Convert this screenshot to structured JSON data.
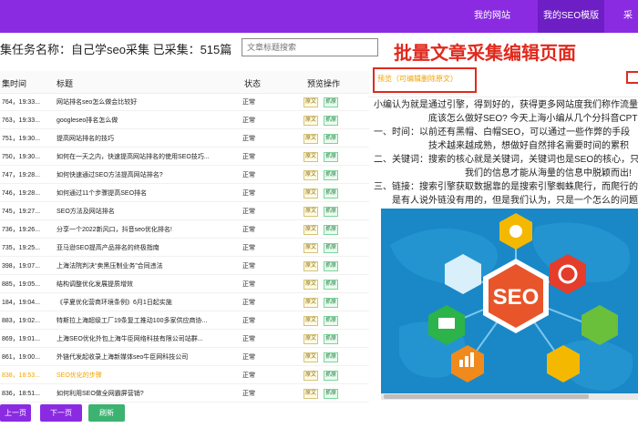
{
  "topbar": {
    "nav": [
      "我的网站",
      "我的SEO模版",
      "采集"
    ]
  },
  "task": {
    "text": "集任务名称：自己学seo采集 已采集：515篇"
  },
  "search": {
    "placeholder": "文章标题搜索"
  },
  "big_title": "批量文章采集编辑页面",
  "table": {
    "headers": [
      "集时间",
      "标题",
      "状态",
      "预览操作"
    ],
    "rows": [
      {
        "time": "764，19:33...",
        "title": "网站排名seo怎么做会比较好",
        "status": "正常"
      },
      {
        "time": "763，19:33...",
        "title": "googleseo排名怎么做",
        "status": "正常"
      },
      {
        "time": "751，19:30...",
        "title": "提高网站排名的技巧",
        "status": "正常"
      },
      {
        "time": "750，19:30...",
        "title": "如何在一天之内，快速提高网站排名的使用SEO技巧...",
        "status": "正常"
      },
      {
        "time": "747，19:28...",
        "title": "如何快速通过SEO方法提高网站排名?",
        "status": "正常"
      },
      {
        "time": "746，19:28...",
        "title": "如何通过11个步骤提高SEO排名",
        "status": "正常"
      },
      {
        "time": "745，19:27...",
        "title": "SEO方法及网站排名",
        "status": "正常"
      },
      {
        "time": "736，19:26...",
        "title": "分享一个2022新风口，抖音seo优化排名!",
        "status": "正常"
      },
      {
        "time": "735，19:25...",
        "title": "亚马逊SEO提高产品排名的终极指南",
        "status": "正常"
      },
      {
        "time": "398，19:07...",
        "title": "上海法院判决“卖黑压制业务”合同违法",
        "status": "正常"
      },
      {
        "time": "885，19:05...",
        "title": "结构调整优化发展提质增效",
        "status": "正常"
      },
      {
        "time": "184，19:04...",
        "title": "《孚夏优化营商环境条例》6月1日起实施",
        "status": "正常"
      },
      {
        "time": "883，19:02...",
        "title": "特斯拉上海超级工厂19条复工推动100多家供应商协...",
        "status": "正常"
      },
      {
        "time": "869，19:01...",
        "title": "上海SEO优化外包上海牛臣网络科技有限公司站群...",
        "status": "正常"
      },
      {
        "time": "861，19:00...",
        "title": "外链代发起收录上海新媒体seo牛臣网科技公司",
        "status": "正常"
      },
      {
        "time": "838，18:53...",
        "title": "SEO优化的步骤",
        "status": "正常"
      },
      {
        "time": "836，18:51...",
        "title": "如何利用SEO做全网霸屏营销?",
        "status": "正常"
      }
    ],
    "tag_labels": [
      "原文",
      "抓原"
    ]
  },
  "buttons": {
    "prev": "上一页",
    "next": "下一页",
    "refresh": "刷新"
  },
  "preview": {
    "label": "预览（可编辑删除原文）",
    "lines": [
      "小编认为就是通过引擎，得到好的，获得更多网站度我们称作流量",
      "底该怎么做好SEO? 今天上海小编从几个分抖音CPT解",
      "一、时间：以前还有黑帽、白帽SEO，可以通过一些作弊的手段",
      "技术越来越成熟，想做好自然排名需要时间的累积",
      "二、关键词：搜索的核心就是关键词，关键词也是SEO的核心，只",
      "我们的信息才能从海量的信息中脱颖而出!",
      "三、链接：搜索引擎获取数据靠的是搜索引擎蜘蛛爬行，而爬行的",
      "是有人说外链没有用的，但是我们认为，只是一个怎么的问题，"
    ],
    "image_text": "SEO"
  },
  "colors": {
    "brand": "#8a2be2",
    "annotation": "#e02a1e",
    "image_bg": "#1a88c7",
    "hex": "#e8552b"
  }
}
